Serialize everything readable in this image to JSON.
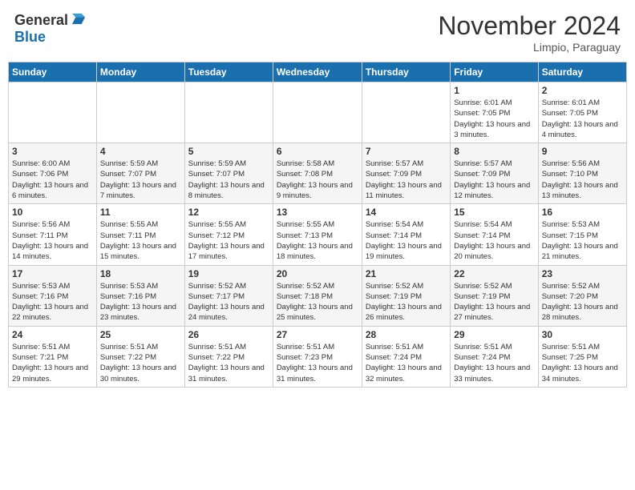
{
  "header": {
    "logo_general": "General",
    "logo_blue": "Blue",
    "month_title": "November 2024",
    "location": "Limpio, Paraguay"
  },
  "calendar": {
    "days_of_week": [
      "Sunday",
      "Monday",
      "Tuesday",
      "Wednesday",
      "Thursday",
      "Friday",
      "Saturday"
    ],
    "weeks": [
      [
        {
          "day": "",
          "info": ""
        },
        {
          "day": "",
          "info": ""
        },
        {
          "day": "",
          "info": ""
        },
        {
          "day": "",
          "info": ""
        },
        {
          "day": "",
          "info": ""
        },
        {
          "day": "1",
          "info": "Sunrise: 6:01 AM\nSunset: 7:05 PM\nDaylight: 13 hours and 3 minutes."
        },
        {
          "day": "2",
          "info": "Sunrise: 6:01 AM\nSunset: 7:05 PM\nDaylight: 13 hours and 4 minutes."
        }
      ],
      [
        {
          "day": "3",
          "info": "Sunrise: 6:00 AM\nSunset: 7:06 PM\nDaylight: 13 hours and 6 minutes."
        },
        {
          "day": "4",
          "info": "Sunrise: 5:59 AM\nSunset: 7:07 PM\nDaylight: 13 hours and 7 minutes."
        },
        {
          "day": "5",
          "info": "Sunrise: 5:59 AM\nSunset: 7:07 PM\nDaylight: 13 hours and 8 minutes."
        },
        {
          "day": "6",
          "info": "Sunrise: 5:58 AM\nSunset: 7:08 PM\nDaylight: 13 hours and 9 minutes."
        },
        {
          "day": "7",
          "info": "Sunrise: 5:57 AM\nSunset: 7:09 PM\nDaylight: 13 hours and 11 minutes."
        },
        {
          "day": "8",
          "info": "Sunrise: 5:57 AM\nSunset: 7:09 PM\nDaylight: 13 hours and 12 minutes."
        },
        {
          "day": "9",
          "info": "Sunrise: 5:56 AM\nSunset: 7:10 PM\nDaylight: 13 hours and 13 minutes."
        }
      ],
      [
        {
          "day": "10",
          "info": "Sunrise: 5:56 AM\nSunset: 7:11 PM\nDaylight: 13 hours and 14 minutes."
        },
        {
          "day": "11",
          "info": "Sunrise: 5:55 AM\nSunset: 7:11 PM\nDaylight: 13 hours and 15 minutes."
        },
        {
          "day": "12",
          "info": "Sunrise: 5:55 AM\nSunset: 7:12 PM\nDaylight: 13 hours and 17 minutes."
        },
        {
          "day": "13",
          "info": "Sunrise: 5:55 AM\nSunset: 7:13 PM\nDaylight: 13 hours and 18 minutes."
        },
        {
          "day": "14",
          "info": "Sunrise: 5:54 AM\nSunset: 7:14 PM\nDaylight: 13 hours and 19 minutes."
        },
        {
          "day": "15",
          "info": "Sunrise: 5:54 AM\nSunset: 7:14 PM\nDaylight: 13 hours and 20 minutes."
        },
        {
          "day": "16",
          "info": "Sunrise: 5:53 AM\nSunset: 7:15 PM\nDaylight: 13 hours and 21 minutes."
        }
      ],
      [
        {
          "day": "17",
          "info": "Sunrise: 5:53 AM\nSunset: 7:16 PM\nDaylight: 13 hours and 22 minutes."
        },
        {
          "day": "18",
          "info": "Sunrise: 5:53 AM\nSunset: 7:16 PM\nDaylight: 13 hours and 23 minutes."
        },
        {
          "day": "19",
          "info": "Sunrise: 5:52 AM\nSunset: 7:17 PM\nDaylight: 13 hours and 24 minutes."
        },
        {
          "day": "20",
          "info": "Sunrise: 5:52 AM\nSunset: 7:18 PM\nDaylight: 13 hours and 25 minutes."
        },
        {
          "day": "21",
          "info": "Sunrise: 5:52 AM\nSunset: 7:19 PM\nDaylight: 13 hours and 26 minutes."
        },
        {
          "day": "22",
          "info": "Sunrise: 5:52 AM\nSunset: 7:19 PM\nDaylight: 13 hours and 27 minutes."
        },
        {
          "day": "23",
          "info": "Sunrise: 5:52 AM\nSunset: 7:20 PM\nDaylight: 13 hours and 28 minutes."
        }
      ],
      [
        {
          "day": "24",
          "info": "Sunrise: 5:51 AM\nSunset: 7:21 PM\nDaylight: 13 hours and 29 minutes."
        },
        {
          "day": "25",
          "info": "Sunrise: 5:51 AM\nSunset: 7:22 PM\nDaylight: 13 hours and 30 minutes."
        },
        {
          "day": "26",
          "info": "Sunrise: 5:51 AM\nSunset: 7:22 PM\nDaylight: 13 hours and 31 minutes."
        },
        {
          "day": "27",
          "info": "Sunrise: 5:51 AM\nSunset: 7:23 PM\nDaylight: 13 hours and 31 minutes."
        },
        {
          "day": "28",
          "info": "Sunrise: 5:51 AM\nSunset: 7:24 PM\nDaylight: 13 hours and 32 minutes."
        },
        {
          "day": "29",
          "info": "Sunrise: 5:51 AM\nSunset: 7:24 PM\nDaylight: 13 hours and 33 minutes."
        },
        {
          "day": "30",
          "info": "Sunrise: 5:51 AM\nSunset: 7:25 PM\nDaylight: 13 hours and 34 minutes."
        }
      ]
    ]
  }
}
